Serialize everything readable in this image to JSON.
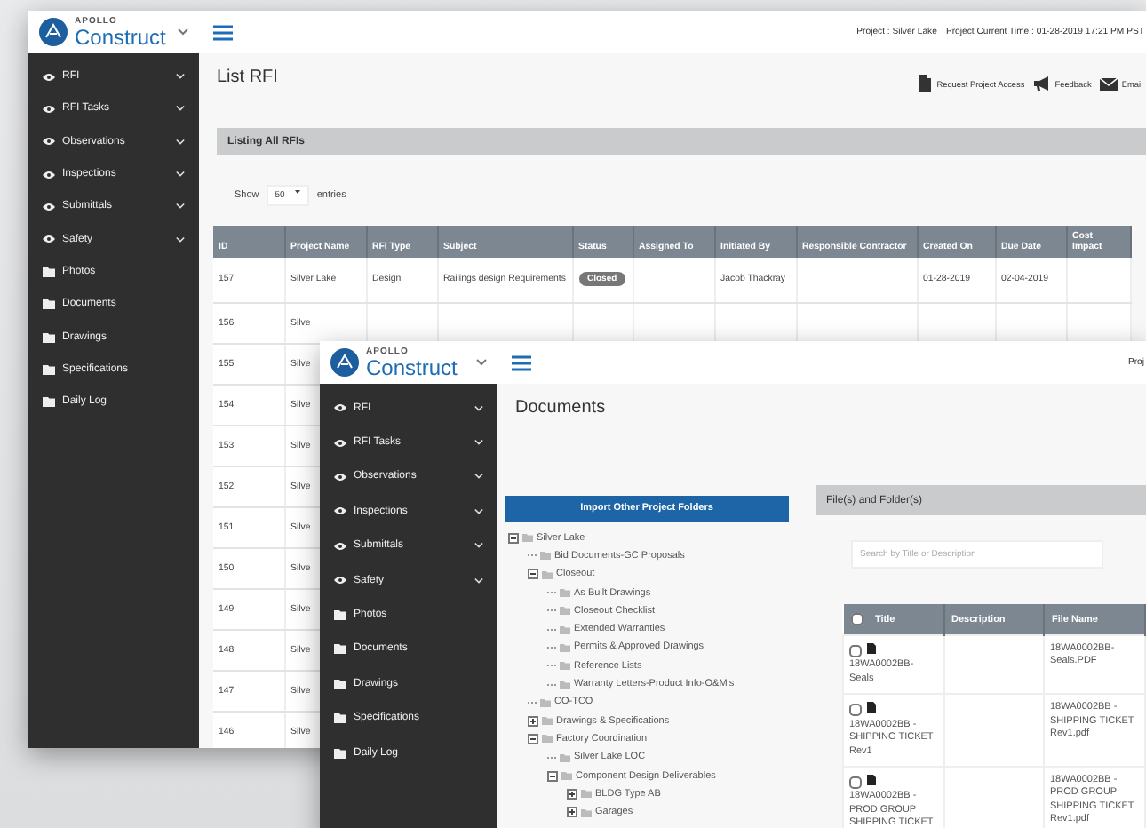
{
  "rfi_window": {
    "logo": {
      "brand": "APOLLO",
      "name": "Construct"
    },
    "header": {
      "project": "Project : Silver Lake",
      "time": "Project Current Time : 01-28-2019 17:21 PM PST"
    },
    "sidebar": [
      {
        "kind": "menu",
        "label": "RFI"
      },
      {
        "kind": "menu",
        "label": "RFI Tasks"
      },
      {
        "kind": "menu",
        "label": "Observations"
      },
      {
        "kind": "menu",
        "label": "Inspections"
      },
      {
        "kind": "menu",
        "label": "Submittals"
      },
      {
        "kind": "menu",
        "label": "Safety"
      },
      {
        "kind": "folder",
        "label": "Photos"
      },
      {
        "kind": "folder",
        "label": "Documents"
      },
      {
        "kind": "folder",
        "label": "Drawings"
      },
      {
        "kind": "folder",
        "label": "Specifications"
      },
      {
        "kind": "folder",
        "label": "Daily Log"
      }
    ],
    "title": "List RFI",
    "actions": [
      {
        "kind": "door",
        "label": "Request Project Access"
      },
      {
        "kind": "megaphone",
        "label": "Feedback"
      },
      {
        "kind": "mail",
        "label": "Emai"
      }
    ],
    "panel_title": "Listing All RFIs",
    "show_entries": {
      "before": "Show",
      "value": "50",
      "after": "entries"
    },
    "table": {
      "columns": [
        "ID",
        "Project Name",
        "RFI Type",
        "Subject",
        "Status",
        "Assigned To",
        "Initiated By",
        "Responsible Contractor",
        "Created On",
        "Due Date",
        "Cost Impact"
      ],
      "rows": [
        {
          "id": "157",
          "project": "Silver Lake",
          "rfi_type": "Design",
          "subject": "Railings design Requirements",
          "status": "Closed",
          "initiated_by": "Jacob Thackray",
          "created_on": "01-28-2019",
          "due_date": "02-04-2019"
        },
        {
          "id": "156",
          "project": "Silve"
        },
        {
          "id": "155",
          "project": "Silve"
        },
        {
          "id": "154",
          "project": "Silve"
        },
        {
          "id": "153",
          "project": "Silve"
        },
        {
          "id": "152",
          "project": "Silve"
        },
        {
          "id": "151",
          "project": "Silve"
        },
        {
          "id": "150",
          "project": "Silve"
        },
        {
          "id": "149",
          "project": "Silve"
        },
        {
          "id": "148",
          "project": "Silve"
        },
        {
          "id": "147",
          "project": "Silve"
        },
        {
          "id": "146",
          "project": "Silve"
        }
      ]
    }
  },
  "documents_window": {
    "logo": {
      "brand": "APOLLO",
      "name": "Construct"
    },
    "header": {
      "project": "Proj"
    },
    "sidebar": [
      {
        "kind": "menu",
        "label": "RFI"
      },
      {
        "kind": "menu",
        "label": "RFI Tasks"
      },
      {
        "kind": "menu",
        "label": "Observations"
      },
      {
        "kind": "menu",
        "label": "Inspections"
      },
      {
        "kind": "menu",
        "label": "Submittals"
      },
      {
        "kind": "menu",
        "label": "Safety"
      },
      {
        "kind": "folder",
        "label": "Photos"
      },
      {
        "kind": "folder",
        "label": "Documents"
      },
      {
        "kind": "folder",
        "label": "Drawings"
      },
      {
        "kind": "folder",
        "label": "Specifications"
      },
      {
        "kind": "folder",
        "label": "Daily Log"
      }
    ],
    "title": "Documents",
    "import_button": "Import Other Project Folders",
    "tree": [
      {
        "label": "Silver Lake",
        "expanded": true,
        "children": [
          {
            "label": "Bid Documents-GC Proposals"
          },
          {
            "label": "Closeout",
            "expanded": true,
            "children": [
              {
                "label": "As Built Drawings"
              },
              {
                "label": "Closeout Checklist"
              },
              {
                "label": "Extended Warranties"
              },
              {
                "label": "Permits & Approved Drawings"
              },
              {
                "label": "Reference Lists"
              },
              {
                "label": "Warranty Letters-Product Info-O&M's"
              }
            ]
          },
          {
            "label": "CO-TCO"
          },
          {
            "label": "Drawings & Specifications",
            "expanded": false
          },
          {
            "label": "Factory Coordination",
            "expanded": true,
            "children": [
              {
                "label": "Silver Lake LOC"
              },
              {
                "label": "Component Design Deliverables",
                "expanded": true,
                "children": [
                  {
                    "label": "BLDG Type AB",
                    "expanded": false
                  },
                  {
                    "label": "Garages",
                    "expanded": false
                  }
                ]
              }
            ]
          }
        ]
      }
    ],
    "files_panel_title": "File(s) and Folder(s)",
    "search": {
      "placeholder": "Search by Title or Description"
    },
    "files_table": {
      "select_all_checked": false,
      "columns": [
        "Title",
        "Description",
        "File Name"
      ],
      "rows": [
        {
          "checked": false,
          "title": "18WA0002BB-Seals",
          "file_name": "18WA0002BB-Seals.PDF"
        },
        {
          "checked": false,
          "title": "18WA0002BB - SHIPPING TICKET Rev1",
          "file_name": "18WA0002BB - SHIPPING TICKET Rev1.pdf"
        },
        {
          "checked": false,
          "title": "18WA0002BB - PROD GROUP SHIPPING TICKET",
          "file_name": "18WA0002BB - PROD GROUP SHIPPING TICKET Rev1.pdf"
        }
      ]
    }
  }
}
